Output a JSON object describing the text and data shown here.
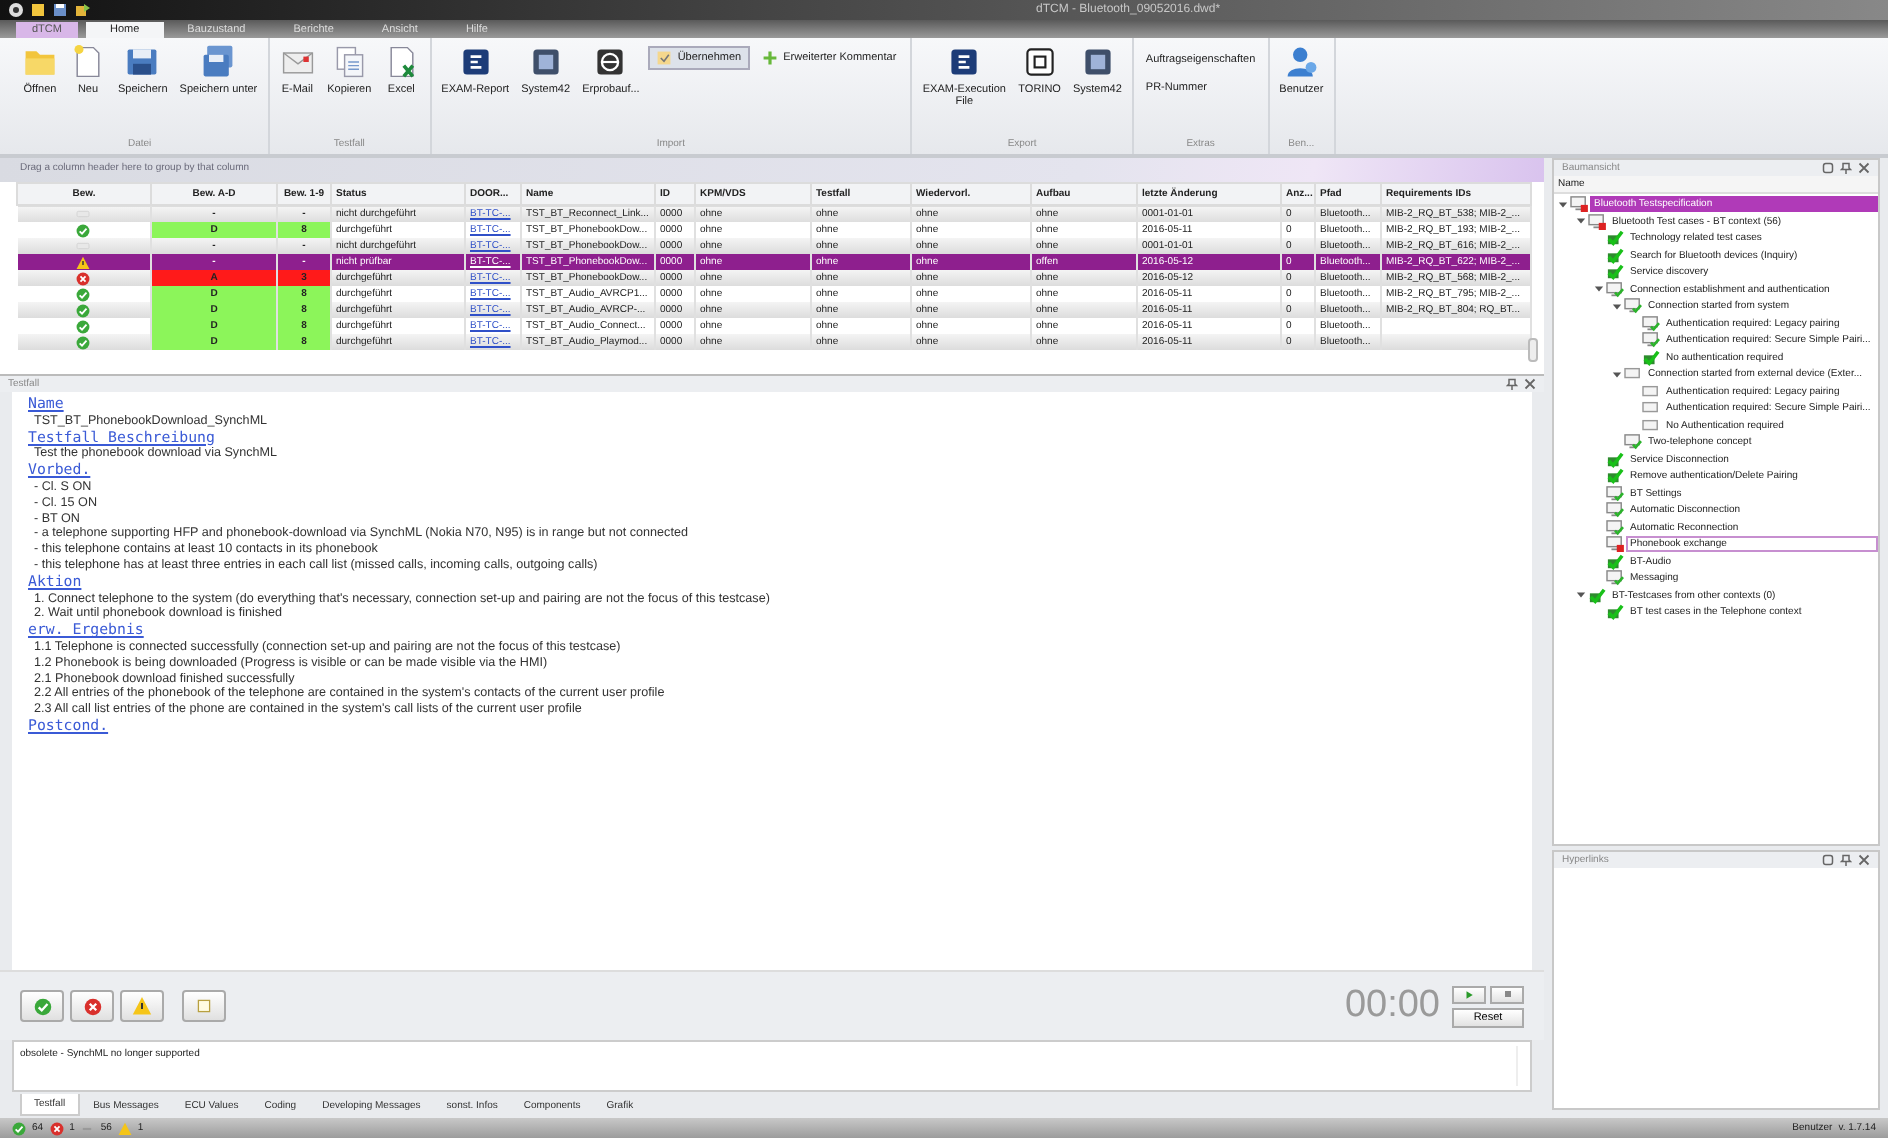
{
  "window": {
    "title": "dTCM - Bluetooth_09052016.dwd*"
  },
  "app_tab": "dTCM",
  "tabs": [
    {
      "label": "Home",
      "selected": true
    },
    {
      "label": "Bauzustand",
      "selected": false
    },
    {
      "label": "Berichte",
      "selected": false
    },
    {
      "label": "Ansicht",
      "selected": false
    },
    {
      "label": "Hilfe",
      "selected": false
    }
  ],
  "ribbon": {
    "groups": [
      {
        "label": "Datei",
        "buttons": [
          {
            "label": "Öffnen",
            "kind": "large",
            "pressed": false
          },
          {
            "label": "Neu",
            "kind": "large",
            "pressed": false
          },
          {
            "label": "Speichern",
            "kind": "large",
            "pressed": false
          },
          {
            "label": "Speichern unter",
            "kind": "large",
            "pressed": false
          }
        ]
      },
      {
        "label": "Testfall",
        "buttons": [
          {
            "label": "E-Mail",
            "kind": "large",
            "pressed": false
          },
          {
            "label": "Kopieren",
            "kind": "large",
            "pressed": false
          },
          {
            "label": "Excel",
            "kind": "large",
            "pressed": false
          }
        ]
      },
      {
        "label": "Import",
        "buttons": [
          {
            "label": "EXAM-Report",
            "kind": "large",
            "pressed": false
          },
          {
            "label": "System42",
            "kind": "large",
            "pressed": false
          },
          {
            "label": "Erprobauf...",
            "kind": "large",
            "pressed": false
          },
          {
            "label": "Übernehmen",
            "kind": "small",
            "pressed": true
          },
          {
            "label": "Erweiterter Kommentar",
            "kind": "small",
            "pressed": false
          }
        ]
      },
      {
        "label": "Export",
        "buttons": [
          {
            "label": "EXAM-Execution File",
            "kind": "large",
            "pressed": false
          },
          {
            "label": "TORINO",
            "kind": "large",
            "pressed": false
          },
          {
            "label": "System42",
            "kind": "large",
            "pressed": false
          }
        ]
      },
      {
        "label": "Extras",
        "buttons": [
          {
            "label": "Auftragseigenschaften",
            "kind": "text",
            "pressed": false
          },
          {
            "label": "PR-Nummer",
            "kind": "text",
            "pressed": false
          }
        ]
      },
      {
        "label": "Ben...",
        "buttons": [
          {
            "label": "Benutzer",
            "kind": "large",
            "pressed": false
          }
        ]
      }
    ]
  },
  "grid": {
    "group_hint": "Drag a column header here to group by that column",
    "rating_columns": [
      "Bew.",
      "Bew. A-D",
      "Bew. 1-9"
    ],
    "columns": [
      "Status",
      "DOOR...",
      "Name",
      "ID",
      "KPM/VDS",
      "Testfall",
      "Wiedervorl.",
      "Aufbau",
      "letzte Änderung",
      "Anz...",
      "Pfad",
      "Requirements IDs"
    ],
    "rows": [
      {
        "selected": false,
        "kind": "none",
        "rating_ad": {
          "text": "-"
        },
        "rating_19": {
          "text": "-"
        },
        "cells": [
          "nicht durchgeführt",
          "BT-TC-...",
          "TST_BT_Reconnect_Link...",
          "0000",
          "ohne",
          "ohne",
          "ohne",
          "ohne",
          "0001-01-01",
          "0",
          "Bluetooth...",
          "MIB-2_RQ_BT_538; MIB-2_..."
        ]
      },
      {
        "selected": false,
        "kind": "ok",
        "rating_ad": {
          "text": "D",
          "color": "#8cf55a"
        },
        "rating_19": {
          "text": "8",
          "color": "#8cf55a"
        },
        "cells": [
          "durchgeführt",
          "BT-TC-...",
          "TST_BT_PhonebookDow...",
          "0000",
          "ohne",
          "ohne",
          "ohne",
          "ohne",
          "2016-05-11",
          "0",
          "Bluetooth...",
          "MIB-2_RQ_BT_193; MIB-2_..."
        ]
      },
      {
        "selected": false,
        "kind": "none",
        "rating_ad": {
          "text": "-"
        },
        "rating_19": {
          "text": "-"
        },
        "cells": [
          "nicht durchgeführt",
          "BT-TC-...",
          "TST_BT_PhonebookDow...",
          "0000",
          "ohne",
          "ohne",
          "ohne",
          "ohne",
          "0001-01-01",
          "0",
          "Bluetooth...",
          "MIB-2_RQ_BT_616; MIB-2_..."
        ]
      },
      {
        "selected": true,
        "kind": "warn",
        "rating_ad": {
          "text": "-"
        },
        "rating_19": {
          "text": "-"
        },
        "cells": [
          "nicht prüfbar",
          "BT-TC-...",
          "TST_BT_PhonebookDow...",
          "0000",
          "ohne",
          "ohne",
          "ohne",
          "offen",
          "2016-05-12",
          "0",
          "Bluetooth...",
          "MIB-2_RQ_BT_622; MIB-2_..."
        ]
      },
      {
        "selected": false,
        "kind": "fail",
        "rating_ad": {
          "text": "A",
          "color": "#ff1a1a"
        },
        "rating_19": {
          "text": "3",
          "color": "#ff1a1a"
        },
        "cells": [
          "durchgeführt",
          "BT-TC-...",
          "TST_BT_PhonebookDow...",
          "0000",
          "ohne",
          "ohne",
          "ohne",
          "ohne",
          "2016-05-12",
          "0",
          "Bluetooth...",
          "MIB-2_RQ_BT_568; MIB-2_..."
        ]
      },
      {
        "selected": false,
        "kind": "ok",
        "rating_ad": {
          "text": "D",
          "color": "#8cf55a"
        },
        "rating_19": {
          "text": "8",
          "color": "#8cf55a"
        },
        "cells": [
          "durchgeführt",
          "BT-TC-...",
          "TST_BT_Audio_AVRCP1...",
          "0000",
          "ohne",
          "ohne",
          "ohne",
          "ohne",
          "2016-05-11",
          "0",
          "Bluetooth...",
          "MIB-2_RQ_BT_795; MIB-2_..."
        ]
      },
      {
        "selected": false,
        "kind": "ok",
        "rating_ad": {
          "text": "D",
          "color": "#8cf55a"
        },
        "rating_19": {
          "text": "8",
          "color": "#8cf55a"
        },
        "cells": [
          "durchgeführt",
          "BT-TC-...",
          "TST_BT_Audio_AVRCP-...",
          "0000",
          "ohne",
          "ohne",
          "ohne",
          "ohne",
          "2016-05-11",
          "0",
          "Bluetooth...",
          "MIB-2_RQ_BT_804; RQ_BT..."
        ]
      },
      {
        "selected": false,
        "kind": "ok",
        "rating_ad": {
          "text": "D",
          "color": "#8cf55a"
        },
        "rating_19": {
          "text": "8",
          "color": "#8cf55a"
        },
        "cells": [
          "durchgeführt",
          "BT-TC-...",
          "TST_BT_Audio_Connect...",
          "0000",
          "ohne",
          "ohne",
          "ohne",
          "ohne",
          "2016-05-11",
          "0",
          "Bluetooth..."
        ]
      },
      {
        "selected": false,
        "kind": "ok",
        "rating_ad": {
          "text": "D",
          "color": "#8cf55a"
        },
        "rating_19": {
          "text": "8",
          "color": "#8cf55a"
        },
        "cells": [
          "durchgeführt",
          "BT-TC-...",
          "TST_BT_Audio_Playmod...",
          "0000",
          "ohne",
          "ohne",
          "ohne",
          "ohne",
          "2016-05-11",
          "0",
          "Bluetooth..."
        ]
      }
    ]
  },
  "testfall": {
    "title": "Testfall",
    "sections": [
      {
        "heading": "Name",
        "lines": [
          "TST_BT_PhonebookDownload_SynchML"
        ]
      },
      {
        "heading": "Testfall Beschreibung",
        "lines": [
          "Test the phonebook download via SynchML"
        ]
      },
      {
        "heading": "Vorbed.",
        "lines": [
          "- Cl. S ON",
          "- Cl. 15 ON",
          "- BT ON",
          "- a telephone supporting HFP and phonebook-download via SynchML (Nokia N70, N95) is in range but not connected",
          "- this telephone contains at least 10 contacts in its phonebook",
          "- this telephone has at least three entries in each call list (missed calls, incoming calls, outgoing calls)"
        ]
      },
      {
        "heading": "Aktion",
        "lines": [
          "1. Connect telephone to the system (do everything that's necessary, connection set-up and pairing are not the focus of this testcase)",
          "2. Wait until phonebook download is finished"
        ]
      },
      {
        "heading": "erw. Ergebnis",
        "lines": [
          "1.1 Telephone is connected successfully (connection set-up and pairing are not the focus of this testcase)",
          "1.2 Phonebook is being downloaded (Progress is visible or can be made visible via the HMI)",
          "2.1 Phonebook download finished successfully",
          "2.2 All entries of the phonebook of the telephone are contained in the system's contacts of the current user profile",
          "2.3 All call list entries of the phone are contained in the system's call lists of the current user profile"
        ]
      },
      {
        "heading": "Postcond."
      }
    ],
    "timer": "00:00",
    "reset": "Reset",
    "comment": "obsolete - SynchML no longer supported",
    "bottom_tabs": [
      {
        "label": "Testfall",
        "selected": true
      },
      {
        "label": "Bus Messages",
        "selected": false
      },
      {
        "label": "ECU Values",
        "selected": false
      },
      {
        "label": "Coding",
        "selected": false
      },
      {
        "label": "Developing Messages",
        "selected": false
      },
      {
        "label": "sonst. Infos",
        "selected": false
      },
      {
        "label": "Components",
        "selected": false
      },
      {
        "label": "Grafik",
        "selected": false
      }
    ]
  },
  "baumansicht": {
    "title": "Baumansicht",
    "column": "Name",
    "items": [
      {
        "label": "Bluetooth Testspecification",
        "kind": "monitor-red",
        "selected": true,
        "focused": false,
        "expanded": true,
        "children": [
          {
            "label": "Bluetooth Test cases - BT context (56)",
            "kind": "monitor-red",
            "selected": false,
            "focused": false,
            "expanded": true,
            "children": [
              {
                "label": "Technology related test cases",
                "kind": "check",
                "selected": false,
                "focused": false
              },
              {
                "label": "Search for Bluetooth devices (Inquiry)",
                "kind": "check",
                "selected": false,
                "focused": false
              },
              {
                "label": "Service discovery",
                "kind": "check",
                "selected": false,
                "focused": false
              },
              {
                "label": "Connection establishment and authentication",
                "kind": "monitor-green",
                "selected": false,
                "focused": false,
                "expanded": true,
                "children": [
                  {
                    "label": "Connection started from system",
                    "kind": "monitor-green",
                    "selected": false,
                    "focused": false,
                    "expanded": true,
                    "children": [
                      {
                        "label": "Authentication required: Legacy pairing",
                        "kind": "monitor-green",
                        "selected": false,
                        "focused": false
                      },
                      {
                        "label": "Authentication required: Secure Simple Pairi...",
                        "kind": "monitor-green",
                        "selected": false,
                        "focused": false
                      },
                      {
                        "label": "No authentication required",
                        "kind": "check",
                        "selected": false,
                        "focused": false
                      }
                    ]
                  },
                  {
                    "label": "Connection started from external device (Exter...",
                    "kind": "monitor-grey",
                    "selected": false,
                    "focused": false,
                    "expanded": true,
                    "children": [
                      {
                        "label": "Authentication required: Legacy pairing",
                        "kind": "monitor-grey",
                        "selected": false,
                        "focused": false
                      },
                      {
                        "label": "Authentication required: Secure Simple Pairi...",
                        "kind": "monitor-grey",
                        "selected": false,
                        "focused": false
                      },
                      {
                        "label": "No Authentication required",
                        "kind": "monitor-grey",
                        "selected": false,
                        "focused": false
                      }
                    ]
                  },
                  {
                    "label": "Two-telephone concept",
                    "kind": "monitor-green",
                    "selected": false,
                    "focused": false
                  }
                ]
              },
              {
                "label": "Service Disconnection",
                "kind": "check",
                "selected": false,
                "focused": false
              },
              {
                "label": "Remove authentication/Delete Pairing",
                "kind": "check",
                "selected": false,
                "focused": false
              },
              {
                "label": "BT Settings",
                "kind": "monitor-green",
                "selected": false,
                "focused": false
              },
              {
                "label": "Automatic Disconnection",
                "kind": "monitor-green",
                "selected": false,
                "focused": false
              },
              {
                "label": "Automatic Reconnection",
                "kind": "monitor-green",
                "selected": false,
                "focused": false
              },
              {
                "label": "Phonebook exchange",
                "kind": "monitor-red",
                "selected": false,
                "focused": true
              },
              {
                "label": "BT-Audio",
                "kind": "check",
                "selected": false,
                "focused": false
              },
              {
                "label": "Messaging",
                "kind": "monitor-green",
                "selected": false,
                "focused": false
              }
            ]
          },
          {
            "label": "BT-Testcases from other contexts (0)",
            "kind": "check",
            "selected": false,
            "focused": false,
            "expanded": true,
            "children": [
              {
                "label": "BT test cases in the Telephone context",
                "kind": "check",
                "selected": false,
                "focused": false
              }
            ]
          }
        ]
      }
    ]
  },
  "hyperlinks": {
    "title": "Hyperlinks"
  },
  "status_bar": {
    "passed": "64",
    "failed": "1",
    "open": "56",
    "warnings": "1",
    "user": "Benutzer",
    "version": "v. 1.7.14"
  }
}
